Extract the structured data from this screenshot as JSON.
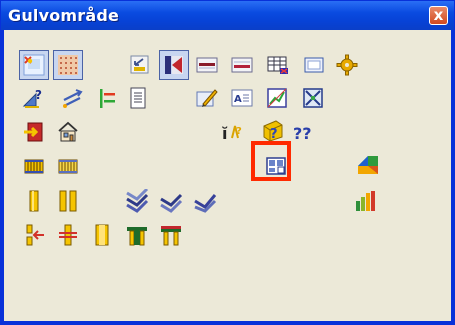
{
  "window": {
    "title": "Gulvområde",
    "close_label": "x"
  },
  "toolbar": {
    "rows": [
      [
        "rooms-icon",
        "grid-icon",
        "export-icon",
        "wall-icon",
        "bar-icon",
        "bar-icon-2",
        "table-icon",
        "frame-icon",
        "gear-icon"
      ],
      [
        "ruler-help-icon",
        "arrow-icon",
        "trim-icon",
        "document-icon",
        "edit-icon",
        "text-icon",
        "chart-icon",
        "cross-icon"
      ],
      [
        "exit-icon",
        "home-icon",
        "info-text-icon",
        "help-icon",
        "double-help-icon"
      ],
      [
        "rail-icon",
        "rail-icon-2",
        "preview-icon",
        "color-icon"
      ],
      [
        "beam-icon",
        "beam-double-icon",
        "stack-icon",
        "stack-icon-2",
        "stack-icon-3",
        "bars-icon"
      ],
      [
        "join-icon",
        "split-icon",
        "column-icon",
        "frame-green-icon",
        "frame-yellow-icon"
      ]
    ]
  },
  "selection_highlight_color": "#ff2a00"
}
